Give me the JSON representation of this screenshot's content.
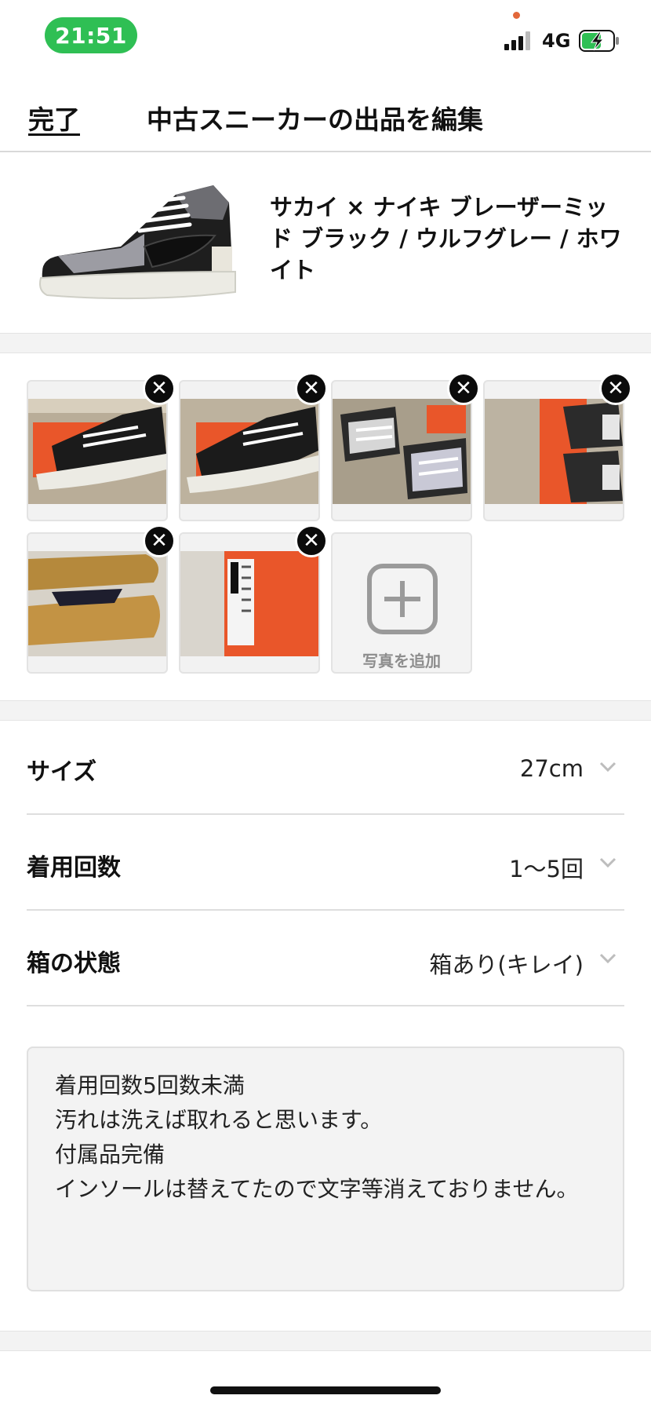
{
  "status_bar": {
    "time": "21:51",
    "network": "4G",
    "icons": [
      "signal-icon",
      "battery-charging-icon"
    ]
  },
  "nav": {
    "done_label": "完了",
    "title": "中古スニーカーの出品を編集"
  },
  "product": {
    "name": "サカイ × ナイキ ブレーザーミッド ブラック / ウルフグレー / ホワイト",
    "image_icon": "sneaker-image"
  },
  "photos": {
    "count": 6,
    "remove_icon": "close-icon",
    "add_label": "写真を追加",
    "add_icon": "plus-icon"
  },
  "attributes": [
    {
      "label": "サイズ",
      "value": "27cm"
    },
    {
      "label": "着用回数",
      "value": "1〜5回"
    },
    {
      "label": "箱の状態",
      "value": "箱あり(キレイ)"
    }
  ],
  "description": {
    "lines": [
      "着用回数5回数未満",
      "汚れは洗えば取れると思います。",
      "付属品完備",
      "インソールは替えてたので文字等消えておりません。"
    ]
  },
  "colors": {
    "accent_green": "#2fbf54",
    "remove_button": "#0b0b0b",
    "box_orange": "#e9562a"
  }
}
